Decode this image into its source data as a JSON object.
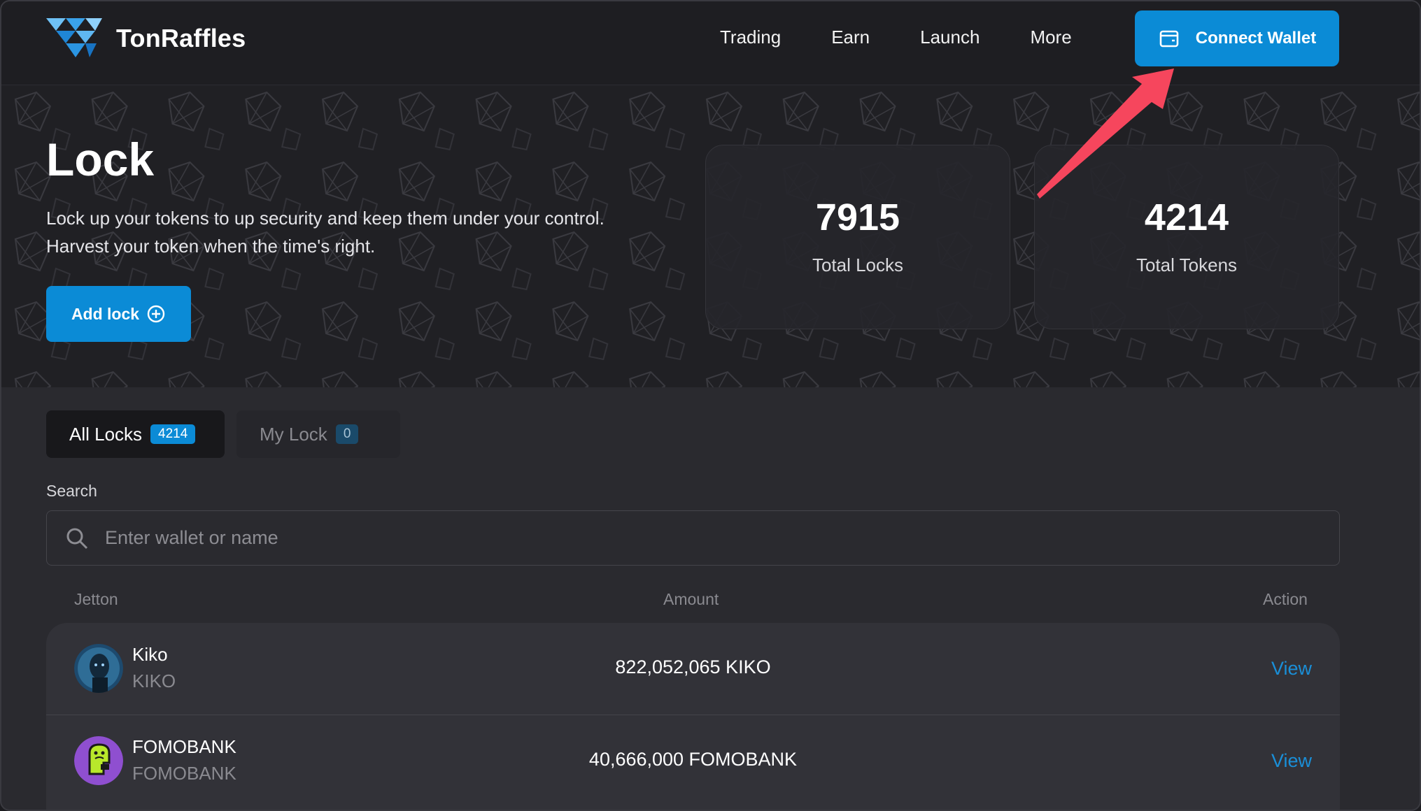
{
  "header": {
    "brand": "TonRaffles",
    "nav": [
      {
        "label": "Trading"
      },
      {
        "label": "Earn"
      },
      {
        "label": "Launch"
      },
      {
        "label": "More"
      }
    ],
    "connect_label": "Connect Wallet"
  },
  "hero": {
    "title": "Lock",
    "description_line1": "Lock up your tokens to up security and keep them under your control.",
    "description_line2": "Harvest your token when the time's right.",
    "add_lock_label": "Add lock",
    "stats": [
      {
        "value": "7915",
        "label": "Total Locks"
      },
      {
        "value": "4214",
        "label": "Total Tokens"
      }
    ]
  },
  "tabs": [
    {
      "label": "All Locks",
      "count": "4214"
    },
    {
      "label": "My Lock",
      "count": "0"
    }
  ],
  "search": {
    "label": "Search",
    "placeholder": "Enter wallet or name",
    "value": ""
  },
  "table": {
    "columns": [
      "Jetton",
      "Amount",
      "Action"
    ],
    "rows": [
      {
        "name": "Kiko",
        "symbol": "KIKO",
        "amount": "822,052,065  KIKO",
        "action": "View"
      },
      {
        "name": "FOMOBANK",
        "symbol": "FOMOBANK",
        "amount": "40,666,000  FOMOBANK",
        "action": "View"
      }
    ]
  },
  "colors": {
    "accent": "#0b8bd6",
    "link": "#1a8fd8",
    "annotation_arrow": "#f6465d"
  }
}
